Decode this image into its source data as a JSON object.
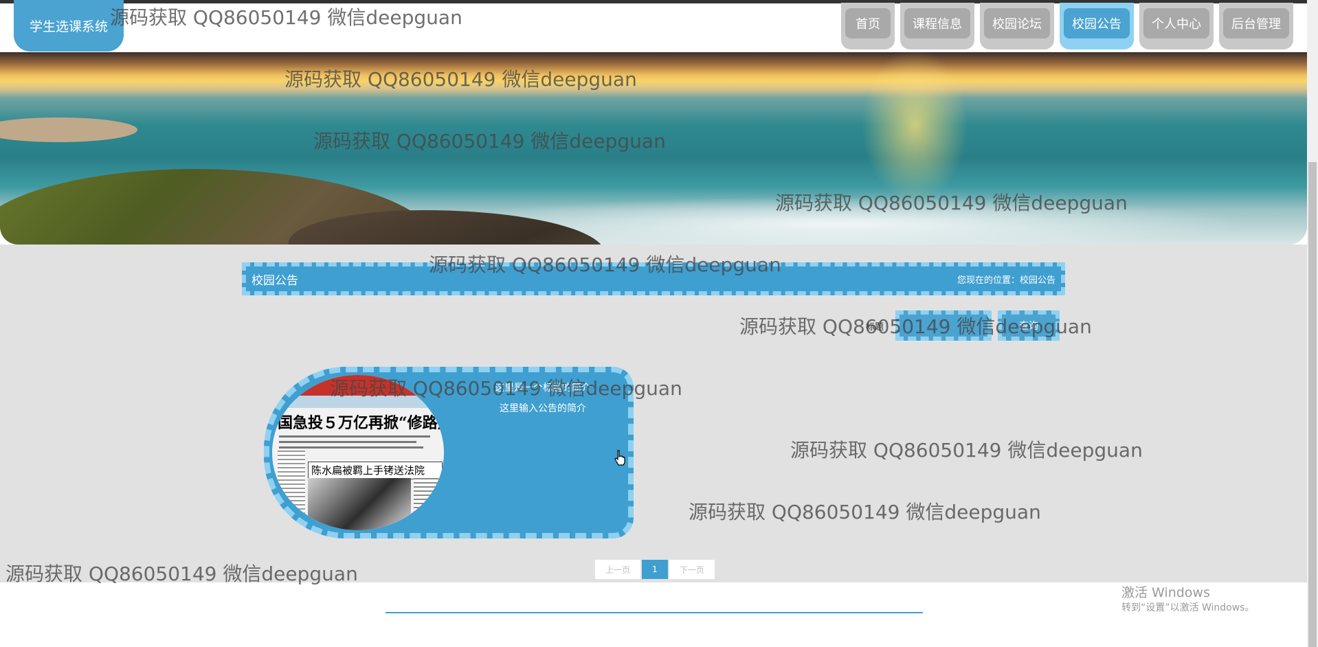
{
  "header": {
    "logo_text": "学生选课系统",
    "nav": [
      {
        "label": "首页",
        "active": false
      },
      {
        "label": "课程信息",
        "active": false
      },
      {
        "label": "校园论坛",
        "active": false
      },
      {
        "label": "校园公告",
        "active": true
      },
      {
        "label": "个人中心",
        "active": false
      },
      {
        "label": "后台管理",
        "active": false
      }
    ]
  },
  "banner": {
    "slides": 3,
    "active_slide": 1
  },
  "section": {
    "title": "校园公告",
    "breadcrumb": "您现在的位置：校园公告"
  },
  "search": {
    "label": "标题",
    "input_value": "",
    "button_label": "查询"
  },
  "announcements": [
    {
      "title": "这里是一个标题的简介",
      "summary": "这里输入公告的简介",
      "newspaper_headline": "国急投５万亿再掀“修路热",
      "newspaper_subhead": "陈水扁被羁上手铐送法院"
    }
  ],
  "pagination": {
    "prev": "上一页",
    "current": "1",
    "next": "下一页"
  },
  "os": {
    "activate_title": "激活 Windows",
    "activate_hint": "转到“设置”以激活 Windows。"
  },
  "watermark": "源码获取 QQ86050149 微信deepguan",
  "colors": {
    "accent": "#3f9fd0",
    "accent_light": "#8fd1f2",
    "nav_inactive": "#a9a9a9",
    "content_bg": "#e1e1e1"
  }
}
